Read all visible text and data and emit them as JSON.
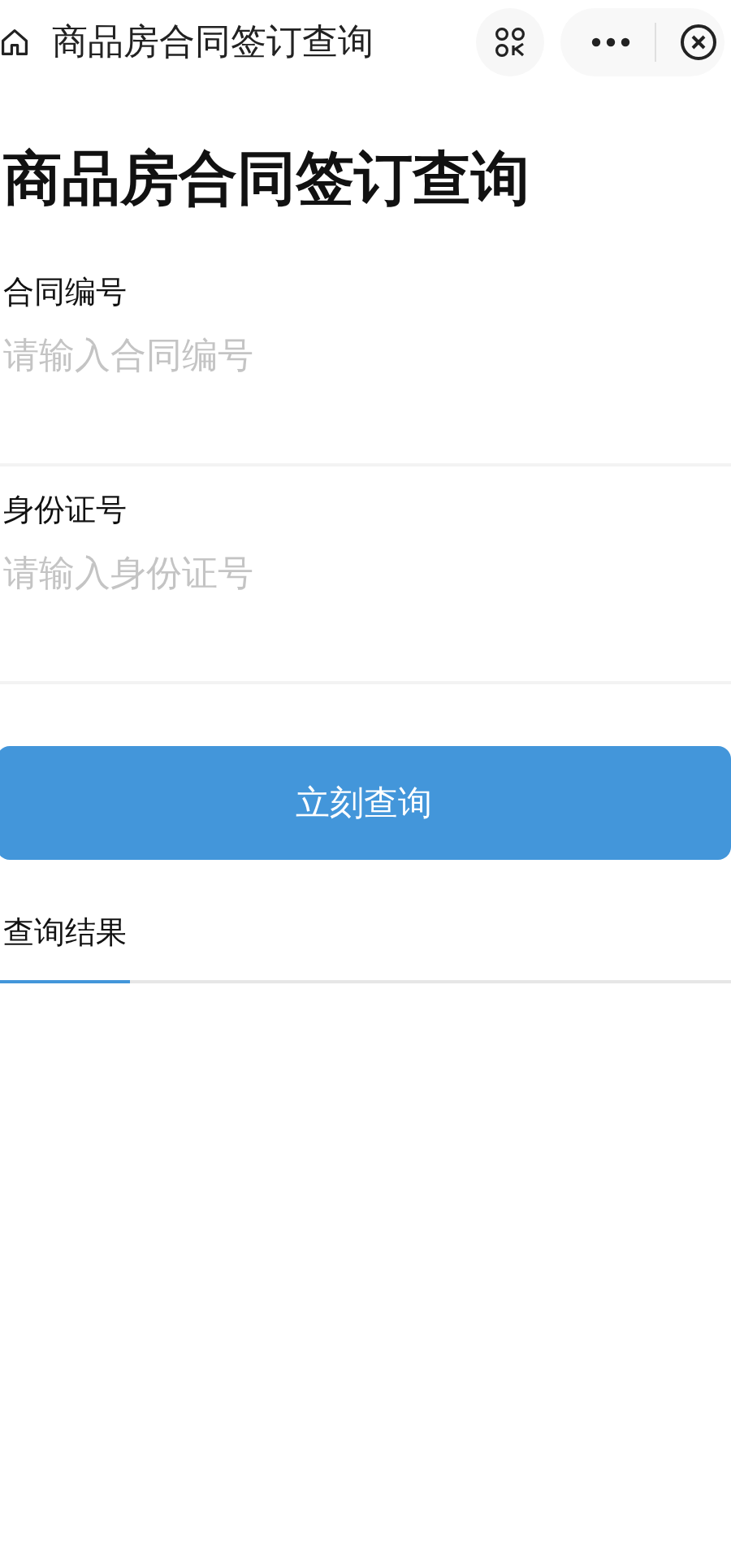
{
  "window": {
    "title": "商品房合同签订查询"
  },
  "page_title": "商品房合同签订查询",
  "fields": [
    {
      "label": "合同编号",
      "placeholder": "请输入合同编号"
    },
    {
      "label": "身份证号",
      "placeholder": "请输入身份证号"
    }
  ],
  "submit_button": "立刻查询",
  "tabs": [
    {
      "label": "查询结果",
      "selected": true
    }
  ]
}
